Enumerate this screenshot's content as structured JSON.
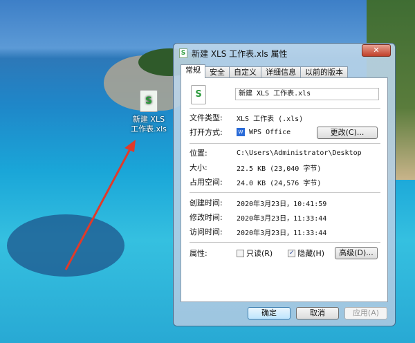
{
  "desktop": {
    "icon_label": "新建 XLS 工作表.xls",
    "arrow_color": "#e03a2a"
  },
  "dialog": {
    "title": "新建 XLS 工作表.xls 属性",
    "close": "✕",
    "tabs": [
      "常规",
      "安全",
      "自定义",
      "详细信息",
      "以前的版本"
    ],
    "filename": "新建 XLS 工作表.xls",
    "fields": {
      "type": {
        "label": "文件类型:",
        "value": "XLS 工作表 (.xls)"
      },
      "open_with": {
        "label": "打开方式:",
        "value": "WPS Office",
        "button": "更改(C)..."
      },
      "location": {
        "label": "位置:",
        "value": "C:\\Users\\Administrator\\Desktop"
      },
      "size": {
        "label": "大小:",
        "value": "22.5 KB (23,040 字节)"
      },
      "disk_size": {
        "label": "占用空间:",
        "value": "24.0 KB (24,576 字节)"
      },
      "created": {
        "label": "创建时间:",
        "value": "2020年3月23日，10:41:59"
      },
      "modified": {
        "label": "修改时间:",
        "value": "2020年3月23日，11:33:44"
      },
      "accessed": {
        "label": "访问时间:",
        "value": "2020年3月23日，11:33:44"
      }
    },
    "attributes": {
      "label": "属性:",
      "readonly": "只读(R)",
      "readonly_checked": false,
      "hidden": "隐藏(H)",
      "hidden_checked": true,
      "advanced": "高级(D)..."
    },
    "buttons": {
      "ok": "确定",
      "cancel": "取消",
      "apply": "应用(A)"
    }
  }
}
